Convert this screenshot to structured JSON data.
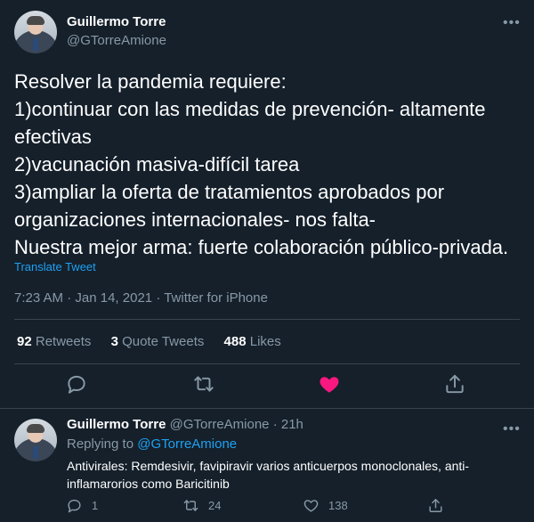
{
  "main_tweet": {
    "author_name": "Guillermo Torre",
    "author_handle": "@GTorreAmione",
    "text": "Resolver la pandemia requiere:\n1)continuar con las medidas de prevención- altamente efectivas\n2)vacunación masiva-difícil tarea\n3)ampliar la oferta de tratamientos aprobados por organizaciones internacionales- nos falta-\nNuestra mejor arma: fuerte colaboración público-privada.",
    "translate_label": "Translate Tweet",
    "time": "7:23 AM",
    "date": "Jan 14, 2021",
    "source": "Twitter for iPhone",
    "separator": "·",
    "stats": {
      "retweets_count": "92",
      "retweets_label": "Retweets",
      "quotes_count": "3",
      "quotes_label": "Quote Tweets",
      "likes_count": "488",
      "likes_label": "Likes"
    },
    "more_icon": "more-horizontal-icon",
    "liked_color": "#f91880"
  },
  "reply_tweet": {
    "author_name": "Guillermo Torre",
    "author_handle": "@GTorreAmione",
    "age": "21h",
    "separator": "·",
    "replying_prefix": "Replying to",
    "replying_handle": "@GTorreAmione",
    "text": "Antivirales: Remdesivir, favipiravir varios anticuerpos monoclonales, anti-inflamarorios como Baricitinib",
    "reply_count": "1",
    "retweet_count": "24",
    "like_count": "138"
  },
  "colors": {
    "background": "#15202b",
    "muted": "#8899a6",
    "accent": "#1da1f2",
    "divider": "#38444d"
  }
}
